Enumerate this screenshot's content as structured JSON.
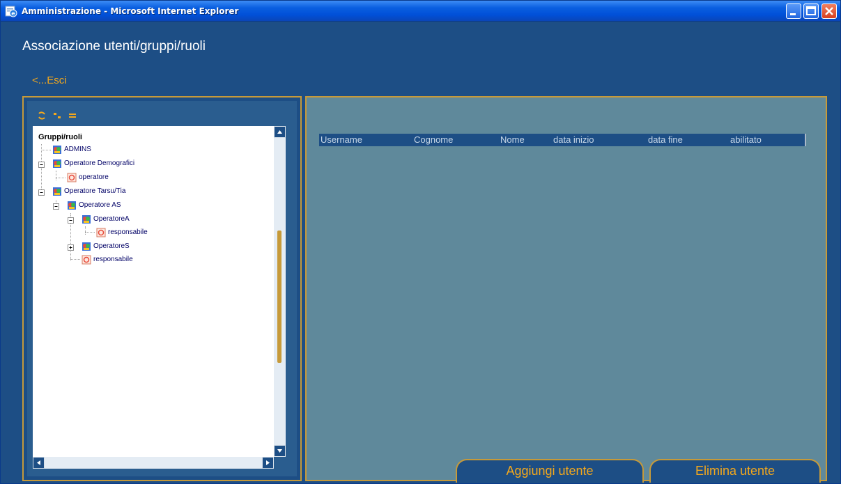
{
  "window": {
    "title": "Amministrazione - Microsoft Internet Explorer"
  },
  "page": {
    "title": "Associazione utenti/gruppi/ruoli",
    "exit_label": "<...Esci"
  },
  "tree": {
    "header": "Gruppi/ruoli",
    "nodes": [
      {
        "label": "ADMINS",
        "type": "group"
      },
      {
        "label": "Operatore Demografici",
        "type": "group",
        "expanded": true
      },
      {
        "label": "operatore",
        "type": "role"
      },
      {
        "label": "Operatore Tarsu/Tia",
        "type": "group",
        "expanded": true
      },
      {
        "label": "Operatore AS",
        "type": "group",
        "expanded": true
      },
      {
        "label": "OperatoreA",
        "type": "group",
        "expanded": true
      },
      {
        "label": "responsabile",
        "type": "role"
      },
      {
        "label": "OperatoreS",
        "type": "group",
        "expanded": false
      },
      {
        "label": "responsabile",
        "type": "role"
      }
    ]
  },
  "table": {
    "columns": [
      "Username",
      "Cognome",
      "Nome",
      "data inizio",
      "data fine",
      "abilitato"
    ],
    "rows": []
  },
  "actions": {
    "add_user": "Aggiungi utente",
    "remove_user": "Elimina utente"
  },
  "colors": {
    "background": "#1d4e85",
    "accent": "#f4a81c",
    "border": "#c69a3a",
    "content_panel": "#5f899b"
  },
  "icons": {
    "group": "group-icon",
    "role": "role-icon",
    "refresh": "refresh-icon",
    "expand_all": "expand-all-icon",
    "collapse_all": "collapse-all-icon"
  }
}
